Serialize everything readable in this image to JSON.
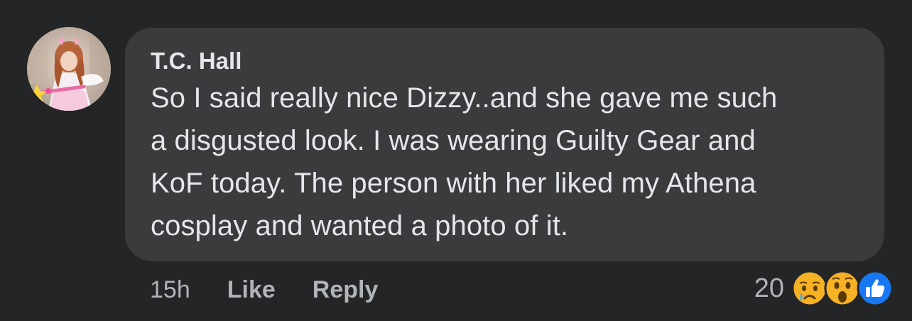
{
  "comment": {
    "author": "T.C. Hall",
    "text": "So I said really nice Dizzy..and she gave me such\na disgusted look.  I was wearing Guilty Gear and\nKoF today.  The person with her liked my Athena\ncosplay and wanted a photo of it.",
    "timestamp": "15h",
    "like_label": "Like",
    "reply_label": "Reply",
    "reaction_count": "20",
    "reactions": [
      "sad-reaction-icon",
      "wow-reaction-icon",
      "like-reaction-icon"
    ]
  },
  "colors": {
    "background": "#242526",
    "bubble": "#3a3b3c",
    "primary_text": "#e4e6eb",
    "secondary_text": "#b0b3b8",
    "like_blue": "#1877f2",
    "emoji_yellow": "#f7b125"
  }
}
